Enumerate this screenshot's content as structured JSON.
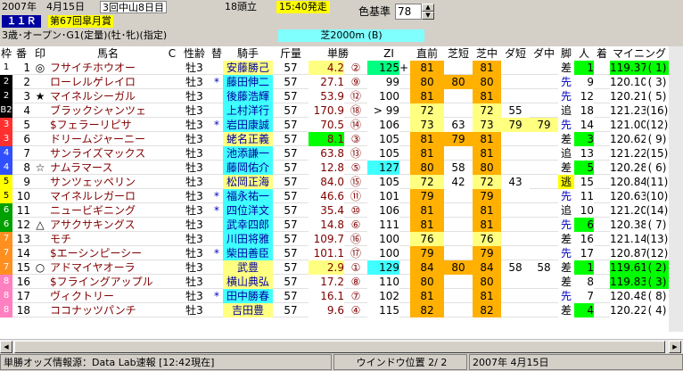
{
  "info": {
    "date": "2007年　4月15日",
    "meeting": "3回中山8日目",
    "runners": "18頭立",
    "post_time": "15:40発走",
    "race_no": "１１Ｒ",
    "race_name": "第67回皐月賞",
    "conditions": "3歳･オープン･G1(定量)(牡･牝)(指定)",
    "course": "芝2000m (B)",
    "color_base_label": "色基準",
    "color_base_value": "78"
  },
  "headers": [
    "枠",
    "番",
    "印",
    "馬名",
    "C",
    "性齢",
    "替",
    "騎手",
    "斤量",
    "単勝",
    "ZI",
    "直前",
    "芝短",
    "芝中",
    "ダ短",
    "ダ中",
    "脚",
    "人",
    "着",
    "マイニング"
  ],
  "rows": [
    {
      "waku": "1",
      "wc": "#ffffff",
      "wt": "#000",
      "no": "1",
      "mark": "◎",
      "name": "フサイチホウオー",
      "sex": "牡3",
      "jc": "",
      "jockey": "安藤勝己",
      "jbg": "#ffff80",
      "kin": "57",
      "odds": "4.2",
      "oc": "#ffff80",
      "pop": "②",
      "zi": "125",
      "zc": "#00ff80",
      "zp": "+",
      "cz": "81",
      "czc": "#ffb000",
      "sd": "",
      "sdc": "",
      "md": "81",
      "mdc": "#ffb000",
      "ds": "",
      "dsc": "",
      "dm": "",
      "dmc": "",
      "ashi": "差",
      "ac": "#ffffff",
      "ninki": "1",
      "nc": "#00ff00",
      "chaku": "",
      "mining": "119.37",
      "mp": "( 1)",
      "mc": "#00ff00"
    },
    {
      "waku": "2",
      "wc": "#000000",
      "wt": "#fff",
      "no": "2",
      "mark": "",
      "name": "ローレルゲレイロ",
      "sex": "牡3",
      "jc": "*",
      "jockey": "藤田伸二",
      "jbg": "#40ffff",
      "kin": "57",
      "odds": "27.1",
      "oc": "#ffffff",
      "pop": "⑨",
      "zi": "99",
      "zc": "#ffffff",
      "zp": "",
      "cz": "80",
      "czc": "#ffb000",
      "sd": "80",
      "sdc": "#ffb000",
      "md": "80",
      "mdc": "#ffb000",
      "ds": "",
      "dsc": "",
      "dm": "",
      "dmc": "",
      "ashi": "先",
      "ac": "#ffffff",
      "ninki": "9",
      "nc": "#ffffff",
      "chaku": "",
      "mining": "120.10",
      "mp": "( 3)",
      "mc": "#ffffff"
    },
    {
      "waku": "2",
      "wc": "#000000",
      "wt": "#fff",
      "no": "3",
      "mark": "★",
      "name": "マイネルシーガル",
      "sex": "牡3",
      "jc": "",
      "jockey": "後藤浩輝",
      "jbg": "#40ffff",
      "kin": "57",
      "odds": "53.9",
      "oc": "#ffffff",
      "pop": "⑫",
      "zi": "100",
      "zc": "#ffffff",
      "zp": "",
      "cz": "81",
      "czc": "#ffb000",
      "sd": "",
      "sdc": "",
      "md": "81",
      "mdc": "#ffb000",
      "ds": "",
      "dsc": "",
      "dm": "",
      "dmc": "",
      "ashi": "先",
      "ac": "#ffffff",
      "ninki": "12",
      "nc": "#ffffff",
      "chaku": "",
      "mining": "120.21",
      "mp": "( 5)",
      "mc": "#ffffff"
    },
    {
      "waku": "B2",
      "wc": "#000000",
      "wt": "#fff",
      "no": "4",
      "mark": "",
      "name": "ブラックシャンツェ",
      "sex": "牡3",
      "jc": "",
      "jockey": "上村洋行",
      "jbg": "#40ffff",
      "kin": "57",
      "odds": "170.9",
      "oc": "#ffffff",
      "pop": "⑱",
      "zi": "> 99",
      "zc": "#ffffff",
      "zp": "",
      "cz": "72",
      "czc": "#ffff80",
      "sd": "",
      "sdc": "",
      "md": "72",
      "mdc": "#ffff80",
      "ds": "55",
      "dsc": "#ffffff",
      "dm": "",
      "dmc": "",
      "ashi": "追",
      "ac": "#ffffff",
      "ninki": "18",
      "nc": "#ffffff",
      "chaku": "",
      "mining": "121.23",
      "mp": "(16)",
      "mc": "#ffffff"
    },
    {
      "waku": "3",
      "wc": "#ff3030",
      "wt": "#fff",
      "no": "5",
      "mark": "",
      "name": "$フェラーリピサ",
      "sex": "牡3",
      "jc": "*",
      "jockey": "岩田康誠",
      "jbg": "#40ffff",
      "kin": "57",
      "odds": "70.5",
      "oc": "#ffffff",
      "pop": "⑭",
      "zi": "106",
      "zc": "#ffffff",
      "zp": "",
      "cz": "73",
      "czc": "#ffff80",
      "sd": "63",
      "sdc": "#ffffff",
      "md": "73",
      "mdc": "#ffff80",
      "ds": "79",
      "dsc": "#ffff80",
      "dm": "79",
      "dmc": "#ffff80",
      "ashi": "先",
      "ac": "#ffffff",
      "ninki": "14",
      "nc": "#ffffff",
      "chaku": "",
      "mining": "121.00",
      "mp": "(12)",
      "mc": "#ffffff"
    },
    {
      "waku": "3",
      "wc": "#ff3030",
      "wt": "#fff",
      "no": "6",
      "mark": "",
      "name": "ドリームジャーニー",
      "sex": "牡3",
      "jc": "",
      "jockey": "蛯名正義",
      "jbg": "#ffff80",
      "kin": "57",
      "odds": "8.1",
      "oc": "#00ff00",
      "pop": "③",
      "zi": "105",
      "zc": "#ffffff",
      "zp": "",
      "cz": "81",
      "czc": "#ffb000",
      "sd": "79",
      "sdc": "#ffb000",
      "md": "81",
      "mdc": "#ffb000",
      "ds": "",
      "dsc": "",
      "dm": "",
      "dmc": "",
      "ashi": "差",
      "ac": "#ffffff",
      "ninki": "3",
      "nc": "#00ff00",
      "chaku": "",
      "mining": "120.62",
      "mp": "( 9)",
      "mc": "#ffffff"
    },
    {
      "waku": "4",
      "wc": "#3050ff",
      "wt": "#fff",
      "no": "7",
      "mark": "",
      "name": "サンライズマックス",
      "sex": "牡3",
      "jc": "",
      "jockey": "池添謙一",
      "jbg": "#40ffff",
      "kin": "57",
      "odds": "63.8",
      "oc": "#ffffff",
      "pop": "⑬",
      "zi": "105",
      "zc": "#ffffff",
      "zp": "",
      "cz": "81",
      "czc": "#ffb000",
      "sd": "",
      "sdc": "",
      "md": "81",
      "mdc": "#ffb000",
      "ds": "",
      "dsc": "",
      "dm": "",
      "dmc": "",
      "ashi": "追",
      "ac": "#ffffff",
      "ninki": "13",
      "nc": "#ffffff",
      "chaku": "",
      "mining": "121.22",
      "mp": "(15)",
      "mc": "#ffffff"
    },
    {
      "waku": "4",
      "wc": "#3050ff",
      "wt": "#fff",
      "no": "8",
      "mark": "☆",
      "name": "ナムラマース",
      "sex": "牡3",
      "jc": "",
      "jockey": "藤岡佑介",
      "jbg": "#40ffff",
      "kin": "57",
      "odds": "12.8",
      "oc": "#ffffff",
      "pop": "⑤",
      "zi": "127",
      "zc": "#40ffff",
      "zp": "",
      "cz": "80",
      "czc": "#ffb000",
      "sd": "58",
      "sdc": "#ffffff",
      "md": "80",
      "mdc": "#ffb000",
      "ds": "",
      "dsc": "",
      "dm": "",
      "dmc": "",
      "ashi": "差",
      "ac": "#ffffff",
      "ninki": "5",
      "nc": "#00ff00",
      "chaku": "",
      "mining": "120.28",
      "mp": "( 6)",
      "mc": "#ffffff"
    },
    {
      "waku": "5",
      "wc": "#ffff00",
      "wt": "#000",
      "no": "9",
      "mark": "",
      "name": "サンツェッペリン",
      "sex": "牡3",
      "jc": "",
      "jockey": "松岡正海",
      "jbg": "#ffff80",
      "kin": "57",
      "odds": "84.0",
      "oc": "#ffffff",
      "pop": "⑮",
      "zi": "105",
      "zc": "#ffffff",
      "zp": "",
      "cz": "72",
      "czc": "#ffff80",
      "sd": "42",
      "sdc": "#ffffff",
      "md": "72",
      "mdc": "#ffff80",
      "ds": "43",
      "dsc": "#ffffff",
      "dm": "",
      "dmc": "",
      "ashi": "逃",
      "ac": "#ffff00",
      "ninki": "15",
      "nc": "#ffffff",
      "chaku": "",
      "mining": "120.84",
      "mp": "(11)",
      "mc": "#ffffff"
    },
    {
      "waku": "5",
      "wc": "#ffff00",
      "wt": "#000",
      "no": "10",
      "mark": "",
      "name": "マイネルレガーロ",
      "sex": "牡3",
      "jc": "*",
      "jockey": "福永祐一",
      "jbg": "#40ffff",
      "kin": "57",
      "odds": "46.6",
      "oc": "#ffffff",
      "pop": "⑪",
      "zi": "101",
      "zc": "#ffffff",
      "zp": "",
      "cz": "79",
      "czc": "#ffb000",
      "sd": "",
      "sdc": "",
      "md": "79",
      "mdc": "#ffb000",
      "ds": "",
      "dsc": "",
      "dm": "",
      "dmc": "",
      "ashi": "先",
      "ac": "#ffffff",
      "ninki": "11",
      "nc": "#ffffff",
      "chaku": "",
      "mining": "120.63",
      "mp": "(10)",
      "mc": "#ffffff"
    },
    {
      "waku": "6",
      "wc": "#00a000",
      "wt": "#fff",
      "no": "11",
      "mark": "",
      "name": "ニュービギニング",
      "sex": "牡3",
      "jc": "*",
      "jockey": "四位洋文",
      "jbg": "#40ffff",
      "kin": "57",
      "odds": "35.4",
      "oc": "#ffffff",
      "pop": "⑩",
      "zi": "106",
      "zc": "#ffffff",
      "zp": "",
      "cz": "81",
      "czc": "#ffb000",
      "sd": "",
      "sdc": "",
      "md": "81",
      "mdc": "#ffb000",
      "ds": "",
      "dsc": "",
      "dm": "",
      "dmc": "",
      "ashi": "追",
      "ac": "#ffffff",
      "ninki": "10",
      "nc": "#ffffff",
      "chaku": "",
      "mining": "121.20",
      "mp": "(14)",
      "mc": "#ffffff"
    },
    {
      "waku": "6",
      "wc": "#00a000",
      "wt": "#fff",
      "no": "12",
      "mark": "△",
      "name": "アサクサキングス",
      "sex": "牡3",
      "jc": "",
      "jockey": "武幸四郎",
      "jbg": "#40ffff",
      "kin": "57",
      "odds": "14.8",
      "oc": "#ffffff",
      "pop": "⑥",
      "zi": "111",
      "zc": "#ffffff",
      "zp": "",
      "cz": "81",
      "czc": "#ffb000",
      "sd": "",
      "sdc": "",
      "md": "81",
      "mdc": "#ffb000",
      "ds": "",
      "dsc": "",
      "dm": "",
      "dmc": "",
      "ashi": "先",
      "ac": "#ffffff",
      "ninki": "6",
      "nc": "#00ff00",
      "chaku": "",
      "mining": "120.38",
      "mp": "( 7)",
      "mc": "#ffffff"
    },
    {
      "waku": "7",
      "wc": "#ff9020",
      "wt": "#fff",
      "no": "13",
      "mark": "",
      "name": "モチ",
      "sex": "牡3",
      "jc": "",
      "jockey": "川田将雅",
      "jbg": "#40ffff",
      "kin": "57",
      "odds": "109.7",
      "oc": "#ffffff",
      "pop": "⑯",
      "zi": "100",
      "zc": "#ffffff",
      "zp": "",
      "cz": "76",
      "czc": "#ffff80",
      "sd": "",
      "sdc": "",
      "md": "76",
      "mdc": "#ffff80",
      "ds": "",
      "dsc": "",
      "dm": "",
      "dmc": "",
      "ashi": "差",
      "ac": "#ffffff",
      "ninki": "16",
      "nc": "#ffffff",
      "chaku": "",
      "mining": "121.14",
      "mp": "(13)",
      "mc": "#ffffff"
    },
    {
      "waku": "7",
      "wc": "#ff9020",
      "wt": "#fff",
      "no": "14",
      "mark": "",
      "name": "$エーシンピーシー",
      "sex": "牡3",
      "jc": "*",
      "jockey": "柴田善臣",
      "jbg": "#40ffff",
      "kin": "57",
      "odds": "101.1",
      "oc": "#ffffff",
      "pop": "⑰",
      "zi": "100",
      "zc": "#ffffff",
      "zp": "",
      "cz": "79",
      "czc": "#ffb000",
      "sd": "",
      "sdc": "",
      "md": "79",
      "mdc": "#ffb000",
      "ds": "",
      "dsc": "",
      "dm": "",
      "dmc": "",
      "ashi": "先",
      "ac": "#ffffff",
      "ninki": "17",
      "nc": "#ffffff",
      "chaku": "",
      "mining": "120.87",
      "mp": "(12)",
      "mc": "#ffffff"
    },
    {
      "waku": "7",
      "wc": "#ff9020",
      "wt": "#fff",
      "no": "15",
      "mark": "○",
      "name": "アドマイヤオーラ",
      "sex": "牡3",
      "jc": "",
      "jockey": "武豊",
      "jbg": "#ffff80",
      "kin": "57",
      "odds": "2.9",
      "oc": "#ffff80",
      "pop": "①",
      "zi": "129",
      "zc": "#40ffff",
      "zp": "",
      "cz": "84",
      "czc": "#ffb000",
      "sd": "80",
      "sdc": "#ffb000",
      "md": "84",
      "mdc": "#ffb000",
      "ds": "58",
      "dsc": "#ffffff",
      "dm": "58",
      "dmc": "#ffffff",
      "ashi": "差",
      "ac": "#ffffff",
      "ninki": "1",
      "nc": "#00ff00",
      "chaku": "",
      "mining": "119.61",
      "mp": "( 2)",
      "mc": "#00ff00"
    },
    {
      "waku": "8",
      "wc": "#ff80c0",
      "wt": "#fff",
      "no": "16",
      "mark": "",
      "name": "$フライングアップル",
      "sex": "牡3",
      "jc": "",
      "jockey": "横山典弘",
      "jbg": "#ffff80",
      "kin": "57",
      "odds": "17.2",
      "oc": "#ffffff",
      "pop": "⑧",
      "zi": "110",
      "zc": "#ffffff",
      "zp": "",
      "cz": "80",
      "czc": "#ffb000",
      "sd": "",
      "sdc": "",
      "md": "80",
      "mdc": "#ffb000",
      "ds": "",
      "dsc": "",
      "dm": "",
      "dmc": "",
      "ashi": "差",
      "ac": "#ffffff",
      "ninki": "8",
      "nc": "#ffffff",
      "chaku": "",
      "mining": "119.83",
      "mp": "( 3)",
      "mc": "#00ff00"
    },
    {
      "waku": "8",
      "wc": "#ff80c0",
      "wt": "#fff",
      "no": "17",
      "mark": "",
      "name": "ヴィクトリー",
      "sex": "牡3",
      "jc": "*",
      "jockey": "田中勝春",
      "jbg": "#40ffff",
      "kin": "57",
      "odds": "16.1",
      "oc": "#ffffff",
      "pop": "⑦",
      "zi": "102",
      "zc": "#ffffff",
      "zp": "",
      "cz": "81",
      "czc": "#ffb000",
      "sd": "",
      "sdc": "",
      "md": "81",
      "mdc": "#ffb000",
      "ds": "",
      "dsc": "",
      "dm": "",
      "dmc": "",
      "ashi": "先",
      "ac": "#ffffff",
      "ninki": "7",
      "nc": "#ffffff",
      "chaku": "",
      "mining": "120.48",
      "mp": "( 8)",
      "mc": "#ffffff"
    },
    {
      "waku": "8",
      "wc": "#ff80c0",
      "wt": "#fff",
      "no": "18",
      "mark": "",
      "name": "ココナッツパンチ",
      "sex": "牡3",
      "jc": "",
      "jockey": "吉田豊",
      "jbg": "#ffff80",
      "kin": "57",
      "odds": "9.6",
      "oc": "#ffffff",
      "pop": "④",
      "zi": "115",
      "zc": "#ffffff",
      "zp": "",
      "cz": "82",
      "czc": "#ffb000",
      "sd": "",
      "sdc": "",
      "md": "82",
      "mdc": "#ffb000",
      "ds": "",
      "dsc": "",
      "dm": "",
      "dmc": "",
      "ashi": "差",
      "ac": "#ffffff",
      "ninki": "4",
      "nc": "#00ff00",
      "chaku": "",
      "mining": "120.22",
      "mp": "( 4)",
      "mc": "#ffffff"
    }
  ],
  "status": {
    "source": "単勝オッズ情報源：Data Lab速報 [12:42現在]",
    "window": "ウインドウ位置 2/ 2",
    "date": "2007年 4月15日"
  }
}
